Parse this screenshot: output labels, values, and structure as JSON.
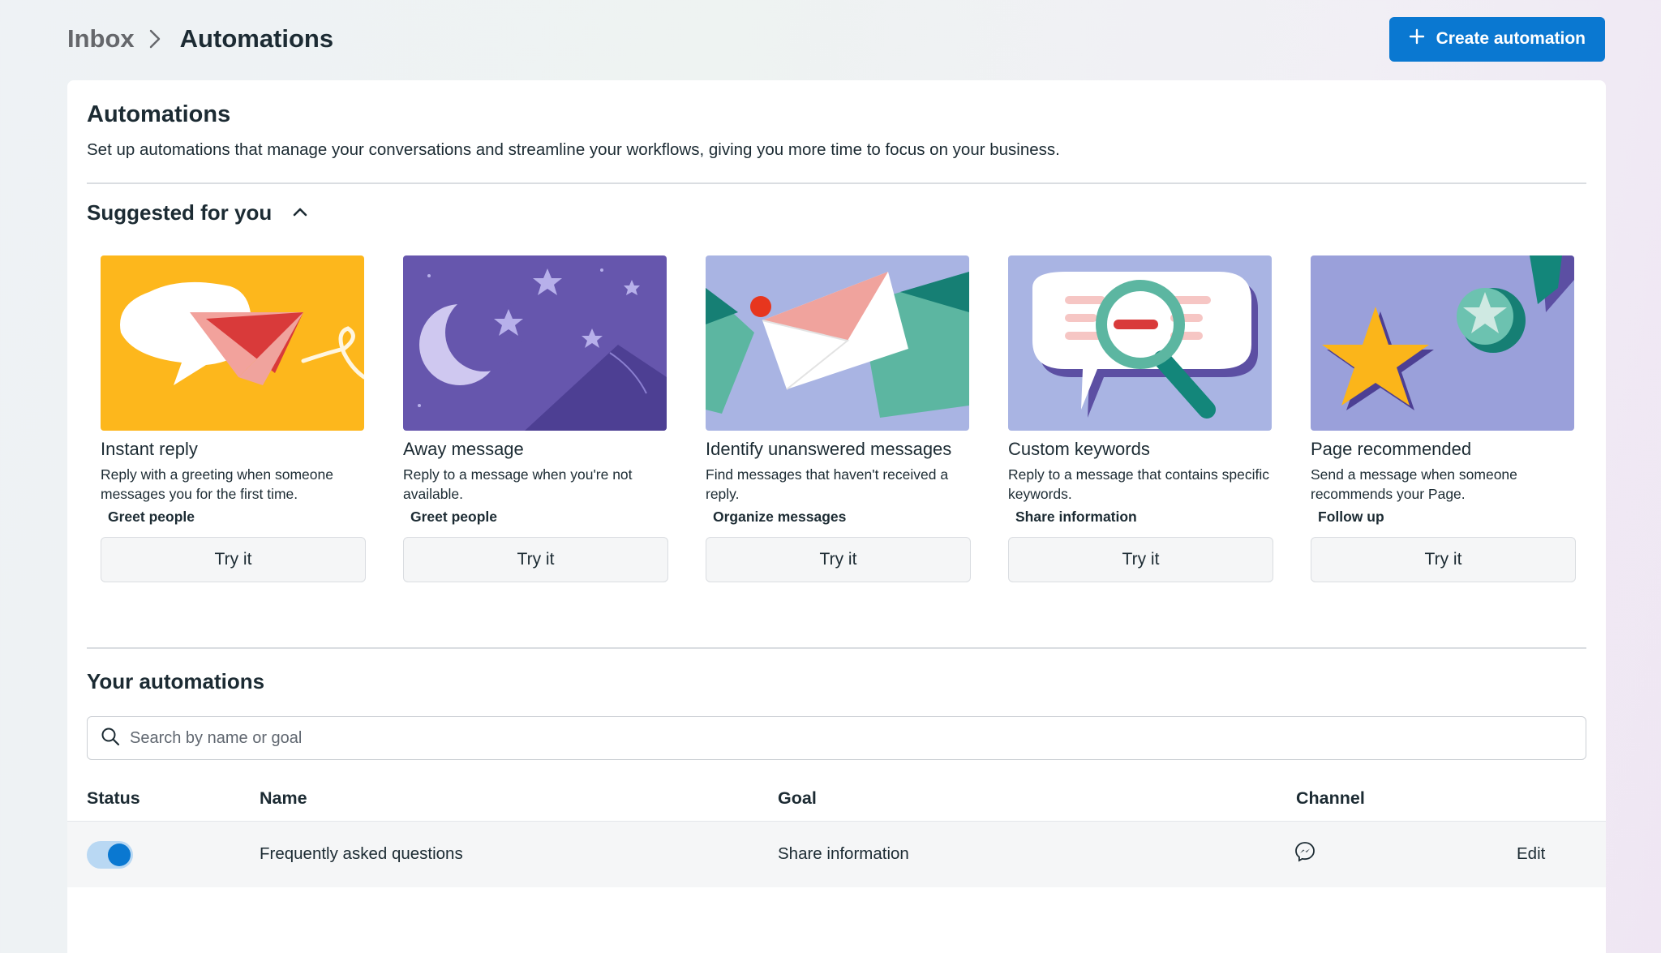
{
  "breadcrumb": {
    "parent": "Inbox",
    "current": "Automations"
  },
  "header": {
    "create_label": "Create automation"
  },
  "intro": {
    "title": "Automations",
    "subtitle": "Set up automations that manage your conversations and streamline your workflows, giving you more time to focus on your business."
  },
  "suggested": {
    "title": "Suggested for you",
    "cards": [
      {
        "title": "Instant reply",
        "desc": "Reply with a greeting when someone messages you for the first time.",
        "tag": "Greet people",
        "button": "Try it"
      },
      {
        "title": "Away message",
        "desc": "Reply to a message when you're not available.",
        "tag": "Greet people",
        "button": "Try it"
      },
      {
        "title": "Identify unanswered messages",
        "desc": "Find messages that haven't received a reply.",
        "tag": "Organize messages",
        "button": "Try it"
      },
      {
        "title": "Custom keywords",
        "desc": "Reply to a message that contains specific keywords.",
        "tag": "Share information",
        "button": "Try it"
      },
      {
        "title": "Page recommended",
        "desc": "Send a message when someone recommends your Page.",
        "tag": "Follow up",
        "button": "Try it"
      }
    ]
  },
  "yours": {
    "title": "Your automations",
    "search_placeholder": "Search by name or goal",
    "columns": {
      "status": "Status",
      "name": "Name",
      "goal": "Goal",
      "channel": "Channel"
    },
    "rows": [
      {
        "enabled": true,
        "name": "Frequently asked questions",
        "goal": "Share information",
        "channel_icon": "messenger-icon",
        "action": "Edit"
      }
    ]
  },
  "colors": {
    "accent": "#0a78d1",
    "text": "#1c2b33"
  }
}
